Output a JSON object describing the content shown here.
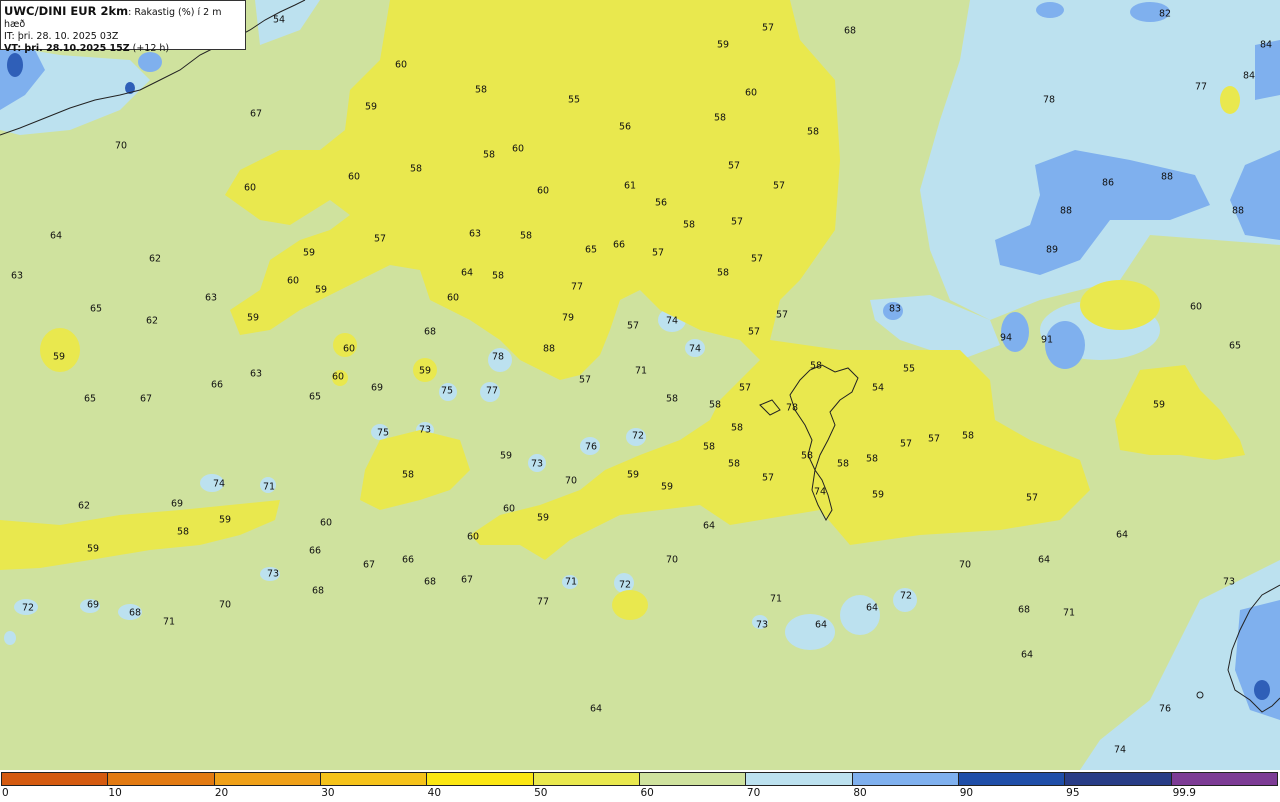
{
  "header": {
    "title_bold": "UWC/DINI EUR 2km",
    "title_rest": ": Rakastig (%) í 2 m hæð",
    "it_line": "IT: þri. 28. 10. 2025 03Z",
    "vt_bold": "VT: þri. 28.10.2025 15Z",
    "vt_rest": " (+12 h)"
  },
  "legend": {
    "labels": [
      "0",
      "10",
      "20",
      "30",
      "40",
      "50",
      "60",
      "70",
      "80",
      "90",
      "95",
      "99.9"
    ],
    "colors": [
      "#d45a10",
      "#e27a12",
      "#efa018",
      "#f5c21a",
      "#fbe612",
      "#e9e84e",
      "#cfe29e",
      "#bce1ef",
      "#7fb0ee",
      "#1f4ea8",
      "#283c86",
      "#7d3b95"
    ]
  },
  "map_colors": {
    "background": "#cfe29e",
    "dry": "#e9e84e",
    "humid": "#bce1ef",
    "very_humid": "#7fb0ee",
    "saturated": "#2f5fb8",
    "land_line": "#222222"
  },
  "values": [
    {
      "v": "54"
    },
    {
      "v": "57"
    },
    {
      "v": "68"
    },
    {
      "v": "82"
    },
    {
      "v": "84"
    },
    {
      "v": "84"
    },
    {
      "v": "59"
    },
    {
      "v": "60"
    },
    {
      "v": "58"
    },
    {
      "v": "55"
    },
    {
      "v": "60"
    },
    {
      "v": "77"
    },
    {
      "v": "78"
    },
    {
      "v": "59"
    },
    {
      "v": "67"
    },
    {
      "v": "58"
    },
    {
      "v": "56"
    },
    {
      "v": "58"
    },
    {
      "v": "70"
    },
    {
      "v": "60"
    },
    {
      "v": "58"
    },
    {
      "v": "58"
    },
    {
      "v": "57"
    },
    {
      "v": "60"
    },
    {
      "v": "61"
    },
    {
      "v": "60"
    },
    {
      "v": "57"
    },
    {
      "v": "86"
    },
    {
      "v": "88"
    },
    {
      "v": "88"
    },
    {
      "v": "60"
    },
    {
      "v": "56"
    },
    {
      "v": "58"
    },
    {
      "v": "57"
    },
    {
      "v": "88"
    },
    {
      "v": "64"
    },
    {
      "v": "57"
    },
    {
      "v": "63"
    },
    {
      "v": "58"
    },
    {
      "v": "65"
    },
    {
      "v": "66"
    },
    {
      "v": "57"
    },
    {
      "v": "62"
    },
    {
      "v": "59"
    },
    {
      "v": "57"
    },
    {
      "v": "89"
    },
    {
      "v": "63"
    },
    {
      "v": "64"
    },
    {
      "v": "58"
    },
    {
      "v": "58"
    },
    {
      "v": "60"
    },
    {
      "v": "59"
    },
    {
      "v": "77"
    },
    {
      "v": "63"
    },
    {
      "v": "60"
    },
    {
      "v": "65"
    },
    {
      "v": "59"
    },
    {
      "v": "62"
    },
    {
      "v": "79"
    },
    {
      "v": "57"
    },
    {
      "v": "74"
    },
    {
      "v": "57"
    },
    {
      "v": "83"
    },
    {
      "v": "60"
    },
    {
      "v": "94"
    },
    {
      "v": "91"
    },
    {
      "v": "68"
    },
    {
      "v": "57"
    },
    {
      "v": "65"
    },
    {
      "v": "60"
    },
    {
      "v": "88"
    },
    {
      "v": "78"
    },
    {
      "v": "74"
    },
    {
      "v": "59"
    },
    {
      "v": "59"
    },
    {
      "v": "63"
    },
    {
      "v": "71"
    },
    {
      "v": "58"
    },
    {
      "v": "55"
    },
    {
      "v": "60"
    },
    {
      "v": "66"
    },
    {
      "v": "69"
    },
    {
      "v": "57"
    },
    {
      "v": "57"
    },
    {
      "v": "54"
    },
    {
      "v": "65"
    },
    {
      "v": "67"
    },
    {
      "v": "65"
    },
    {
      "v": "75"
    },
    {
      "v": "77"
    },
    {
      "v": "58"
    },
    {
      "v": "58"
    },
    {
      "v": "78"
    },
    {
      "v": "58"
    },
    {
      "v": "59"
    },
    {
      "v": "75"
    },
    {
      "v": "73"
    },
    {
      "v": "72"
    },
    {
      "v": "58"
    },
    {
      "v": "57"
    },
    {
      "v": "57"
    },
    {
      "v": "58"
    },
    {
      "v": "76"
    },
    {
      "v": "58"
    },
    {
      "v": "59"
    },
    {
      "v": "73"
    },
    {
      "v": "58"
    },
    {
      "v": "58"
    },
    {
      "v": "58"
    },
    {
      "v": "58"
    },
    {
      "v": "70"
    },
    {
      "v": "59"
    },
    {
      "v": "57"
    },
    {
      "v": "74"
    },
    {
      "v": "71"
    },
    {
      "v": "59"
    },
    {
      "v": "74"
    },
    {
      "v": "59"
    },
    {
      "v": "57"
    },
    {
      "v": "62"
    },
    {
      "v": "69"
    },
    {
      "v": "60"
    },
    {
      "v": "59"
    },
    {
      "v": "58"
    },
    {
      "v": "60"
    },
    {
      "v": "59"
    },
    {
      "v": "60"
    },
    {
      "v": "64"
    },
    {
      "v": "64"
    },
    {
      "v": "59"
    },
    {
      "v": "66"
    },
    {
      "v": "70"
    },
    {
      "v": "70"
    },
    {
      "v": "64"
    },
    {
      "v": "73"
    },
    {
      "v": "67"
    },
    {
      "v": "66"
    },
    {
      "v": "67"
    },
    {
      "v": "71"
    },
    {
      "v": "72"
    },
    {
      "v": "68"
    },
    {
      "v": "68"
    },
    {
      "v": "71"
    },
    {
      "v": "72"
    },
    {
      "v": "72"
    },
    {
      "v": "69"
    },
    {
      "v": "68"
    },
    {
      "v": "70"
    },
    {
      "v": "71"
    },
    {
      "v": "77"
    },
    {
      "v": "73"
    },
    {
      "v": "64"
    },
    {
      "v": "64"
    },
    {
      "v": "68"
    },
    {
      "v": "71"
    },
    {
      "v": "73"
    },
    {
      "v": "64"
    },
    {
      "v": "64"
    },
    {
      "v": "76"
    },
    {
      "v": "74"
    }
  ]
}
